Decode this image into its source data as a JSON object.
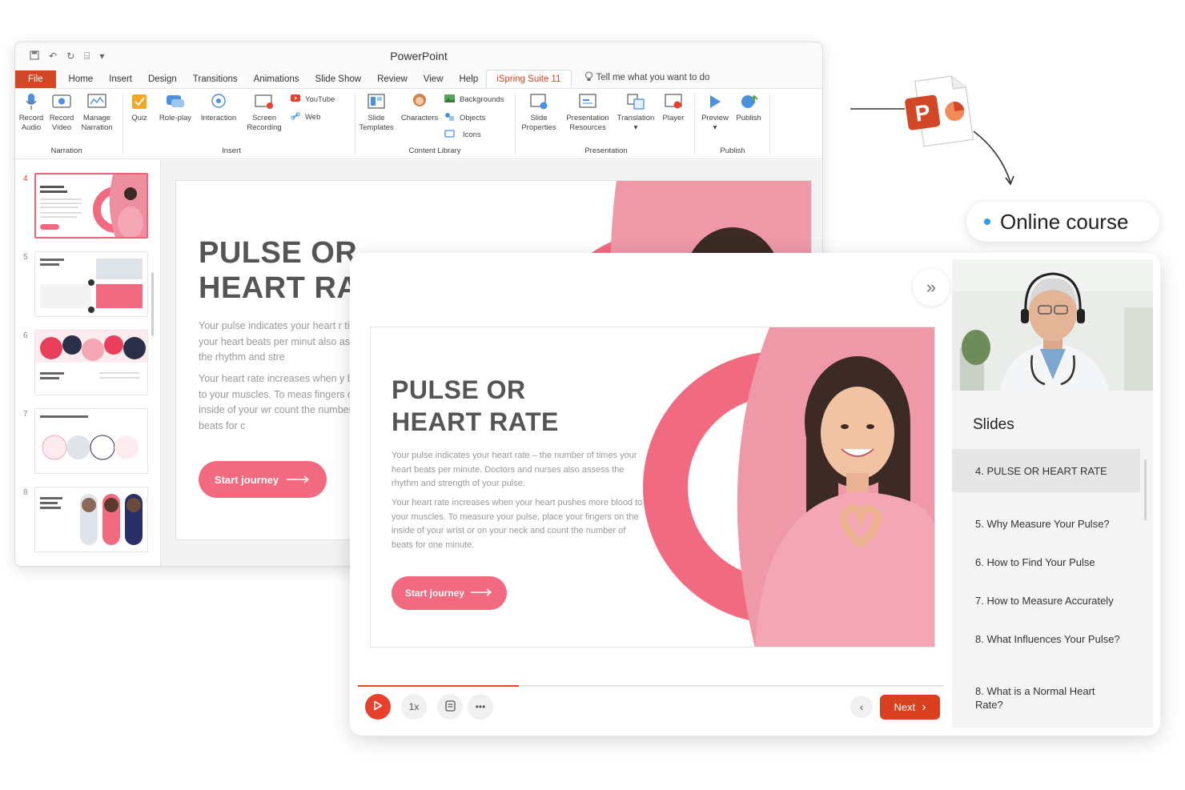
{
  "ppt": {
    "app_title": "PowerPoint",
    "tabs": [
      "File",
      "Home",
      "Insert",
      "Design",
      "Transitions",
      "Animations",
      "Slide Show",
      "Review",
      "View",
      "Help",
      "iSpring Suite 11"
    ],
    "tell_me": "Tell me what you want to do",
    "ribbon": {
      "record_audio": [
        "Record",
        "Audio"
      ],
      "record_video": [
        "Record",
        "Video"
      ],
      "manage_narration": [
        "Manage",
        "Narration"
      ],
      "group_narration": "Narration",
      "quiz": "Quiz",
      "role_play": "Role-play",
      "interaction": "Interaction",
      "screen_recording": [
        "Screen",
        "Recording"
      ],
      "youtube": "YouTube",
      "web": "Web",
      "group_insert": "Insert",
      "slide_templates": [
        "Slide",
        "Templates"
      ],
      "characters": "Characters",
      "backgrounds": "Backgrounds",
      "objects": "Objects",
      "icons": "Icons",
      "group_content_library": "Content Library",
      "slide_properties": [
        "Slide",
        "Properties"
      ],
      "presentation_resources": [
        "Presentation",
        "Resources"
      ],
      "translation": "Translation",
      "player": "Player",
      "group_presentation": "Presentation",
      "preview": "Preview",
      "publish": "Publish",
      "group_publish": "Publish"
    },
    "thumbnails": [
      "4",
      "5",
      "6",
      "7",
      "8"
    ],
    "slide": {
      "title_line1": "PULSE OR",
      "title_line2": "HEART RA",
      "para1": "Your pulse indicates your heart r times your heart beats per minut also assess the rhythm and stre",
      "para2": "Your heart rate increases when y blood to your muscles. To meas fingers on the inside of your wr count the number of beats for c",
      "button": "Start journey"
    }
  },
  "badge": {
    "label": "Online course"
  },
  "player": {
    "slide": {
      "title_line1": "PULSE OR",
      "title_line2": "HEART RATE",
      "para1": "Your pulse indicates your heart rate – the number of times your heart beats per minute. Doctors and nurses also assess the rhythm and strength of your pulse.",
      "para2": "Your heart rate increases when your heart pushes more blood to your muscles. To measure your pulse, place your fingers on the inside of your wrist or on your neck and count the number of beats for one minute.",
      "button": "Start journey"
    },
    "speed": "1x",
    "next_label": "Next",
    "progress_fraction": 0.275,
    "slides_heading": "Slides",
    "slides": [
      {
        "label": "4. PULSE OR HEART RATE",
        "active": true
      },
      {
        "label": "5. Why Measure Your Pulse?",
        "active": false
      },
      {
        "label": "6. How to Find Your Pulse",
        "active": false
      },
      {
        "label": "7. How to Measure Accurately",
        "active": false
      },
      {
        "label": "8. What Influences Your Pulse?",
        "active": false
      },
      {
        "label": "8. What is a Normal Heart Rate?",
        "active": false
      }
    ]
  },
  "colors": {
    "accent": "#d24726",
    "pink": "#f26a80",
    "next": "#d9401f",
    "dot": "#2a9df4"
  }
}
